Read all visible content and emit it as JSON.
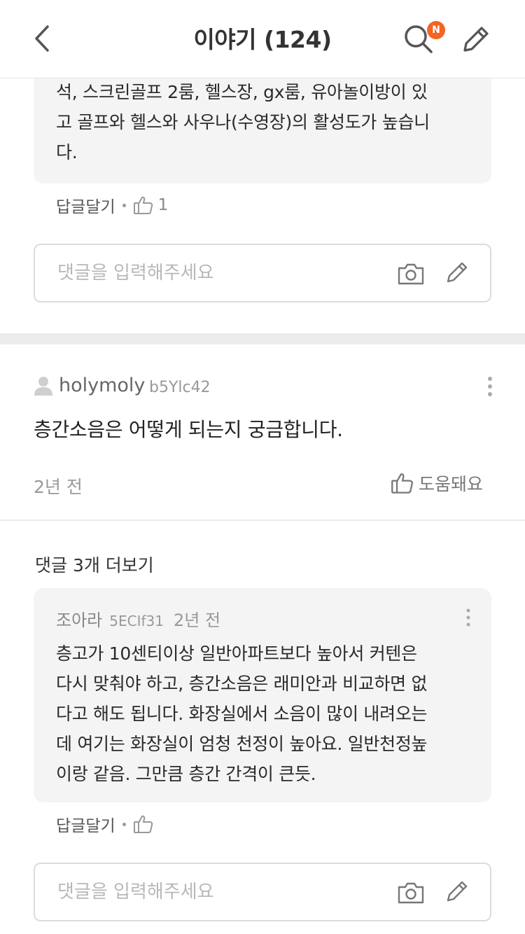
{
  "header": {
    "title": "이야기 (124)",
    "badge": "N",
    "badge_color": "#f26522"
  },
  "reply_top": {
    "lines": [
      "석, 스크린골프 2룸, 헬스장, gx룸, 유아놀이방이 있",
      "고 골프와 헬스와 사우나(수영장)의 활성도가 높습니",
      "다."
    ],
    "reply_label": "답글달기",
    "like_count": "1"
  },
  "comment_input_1": {
    "placeholder": "댓글을 입력해주세요"
  },
  "post": {
    "username": "holymoly",
    "usercode": "b5Ylc42",
    "text": "층간소음은 어떻게 되는지 궁금합니다.",
    "time": "2년 전",
    "helpful_label": "도움돼요",
    "more_replies_label": "댓글 3개 더보기"
  },
  "reply_2": {
    "author": "조아라",
    "code": "5ECIf31",
    "time": "2년 전",
    "lines": [
      "층고가 10센티이상 일반아파트보다 높아서 커텐은",
      "다시 맞춰야 하고, 층간소음은 래미안과 비교하면 없",
      "다고 해도 됩니다. 화장실에서 소음이 많이 내려오는",
      "데 여기는 화장실이 엄청 천정이 높아요. 일반천정높",
      "이랑 같음. 그만큼 층간 간격이 큰듯."
    ],
    "reply_label": "답글달기"
  },
  "comment_input_2": {
    "placeholder": "댓글을 입력해주세요"
  },
  "icons": [
    "back-arrow-icon",
    "search-icon",
    "pencil-icon",
    "thumbs-up-icon",
    "camera-icon",
    "user-icon",
    "more-vertical-icon"
  ]
}
